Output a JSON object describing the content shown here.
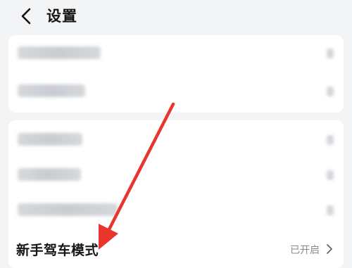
{
  "header": {
    "title": "设置",
    "back_icon": "chevron-left-icon"
  },
  "group1": {
    "items": [
      {
        "label": "",
        "blurred": true
      },
      {
        "label": "",
        "blurred": true
      }
    ]
  },
  "group2": {
    "items": [
      {
        "label": "",
        "blurred": true
      },
      {
        "label": "",
        "blurred": true
      },
      {
        "label": "",
        "blurred": true
      }
    ],
    "novice_mode": {
      "label": "新手驾车模式",
      "status": "已开启",
      "chevron_icon": "chevron-right-icon"
    }
  },
  "annotation": {
    "type": "arrow",
    "color": "#e8362f"
  }
}
